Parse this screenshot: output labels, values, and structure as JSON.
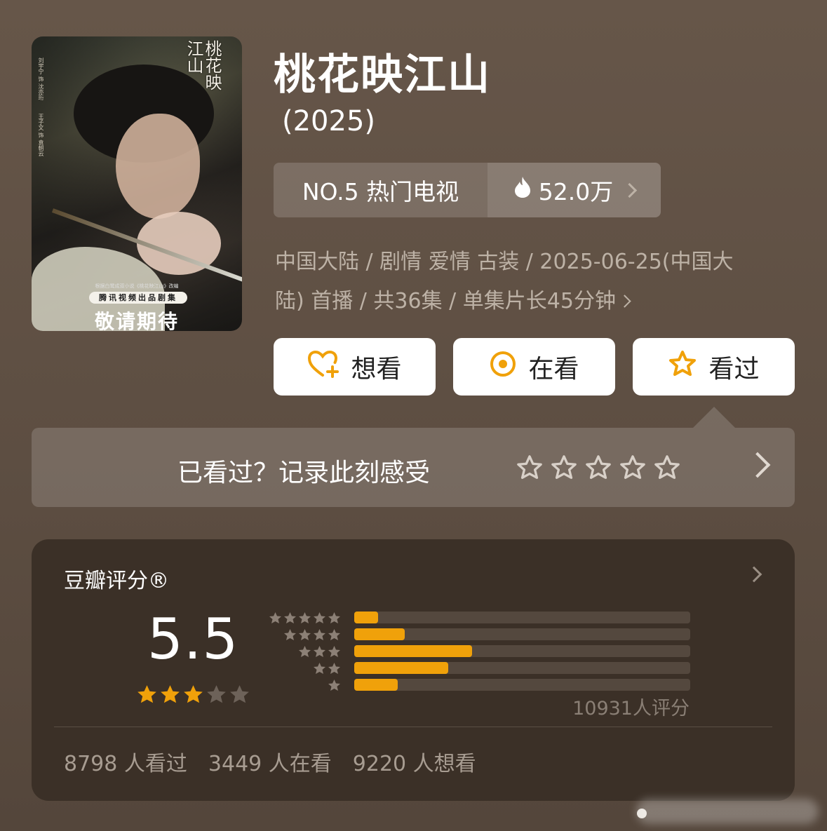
{
  "poster": {
    "logo": "桃花映江山",
    "credits_left": "刘宇宁 饰 沈亦珩",
    "credits_left2": "王子文 饰 袁朝云",
    "pill": "腾讯视频出品剧集",
    "tagline_small": "根据白鹭成双小说《桃花映江山》改编",
    "tagline_big": "敬请期待"
  },
  "title": "桃花映江山",
  "year": "(2025)",
  "rank": {
    "left": "NO.5 热门电视",
    "heat": "52.0万"
  },
  "meta": {
    "line1": "中国大陆 / 剧情 爱情 古装 / 2025-06-25(中国大",
    "line2": "陆) 首播 / 共36集 / 单集片长45分钟"
  },
  "actions": {
    "want": "想看",
    "watching": "在看",
    "watched": "看过"
  },
  "record": {
    "label": "已看过？记录此刻感受"
  },
  "rating": {
    "header": "豆瓣评分®",
    "score": "5.5",
    "star_level": 2.75,
    "votes": "10931人评分",
    "summary": {
      "watched": "8798 人看过",
      "watching": "3449 人在看",
      "want": "9220 人想看"
    },
    "distribution": [
      {
        "stars": 5,
        "percent": 7
      },
      {
        "stars": 4,
        "percent": 15
      },
      {
        "stars": 3,
        "percent": 35
      },
      {
        "stars": 2,
        "percent": 28
      },
      {
        "stars": 1,
        "percent": 13
      }
    ]
  },
  "colors": {
    "accent": "#f0a10a",
    "card": "#3b3027",
    "bg": "#5f5044"
  },
  "icons": {
    "want": "heart-plus-icon",
    "watching": "target-icon",
    "watched": "star-outline-icon",
    "heat": "flame-icon"
  }
}
